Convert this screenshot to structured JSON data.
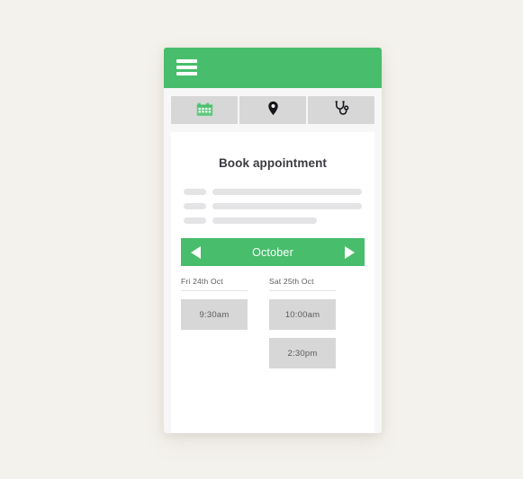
{
  "theme": {
    "accent_green": "#48bd6b",
    "page_background": "#f4f2ec",
    "tab_gray": "#d7d7d7",
    "skeleton_gray": "#e4e4e6"
  },
  "header": {
    "menu_icon": "hamburger-menu-icon"
  },
  "tabs": [
    {
      "icon": "calendar-icon",
      "active": true
    },
    {
      "icon": "location-pin-icon",
      "active": false
    },
    {
      "icon": "stethoscope-icon",
      "active": false
    }
  ],
  "main": {
    "title": "Book appointment",
    "skeleton_rows": [
      {
        "bar_width": "full"
      },
      {
        "bar_width": "full"
      },
      {
        "bar_width": "short"
      }
    ]
  },
  "month_nav": {
    "prev_icon": "triangle-left-icon",
    "month": "October",
    "next_icon": "triangle-right-icon"
  },
  "day_columns": [
    {
      "date_label": "Fri 24th Oct",
      "slots": [
        "9:30am"
      ]
    },
    {
      "date_label": "Sat 25th Oct",
      "slots": [
        "10:00am",
        "2:30pm"
      ]
    }
  ]
}
